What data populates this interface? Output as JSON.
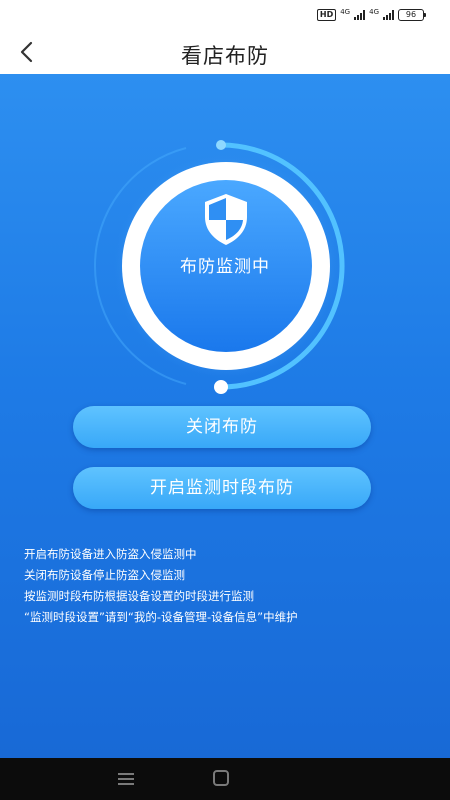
{
  "status_bar": {
    "hd": "HD",
    "network_1": "4G",
    "network_2": "4G",
    "battery": "96"
  },
  "nav": {
    "title": "看店布防",
    "back_icon": "chevron-left-icon"
  },
  "radar": {
    "shield_icon": "shield-icon",
    "status_text": "布防监测中"
  },
  "buttons": {
    "close_label": "关闭布防",
    "schedule_label": "开启监测时段布防"
  },
  "notes": [
    "开启布防设备进入防盗入侵监测中",
    "关闭布防设备停止防盗入侵监测",
    "按监测时段布防根据设备设置的时段进行监测",
    "“监测时段设置”请到“我的-设备管理-设备信息”中维护"
  ],
  "colors": {
    "background_top": "#2d8ff0",
    "background_bottom": "#1869d6",
    "button": "#45b3fb",
    "ring": "#4fc0ff"
  }
}
